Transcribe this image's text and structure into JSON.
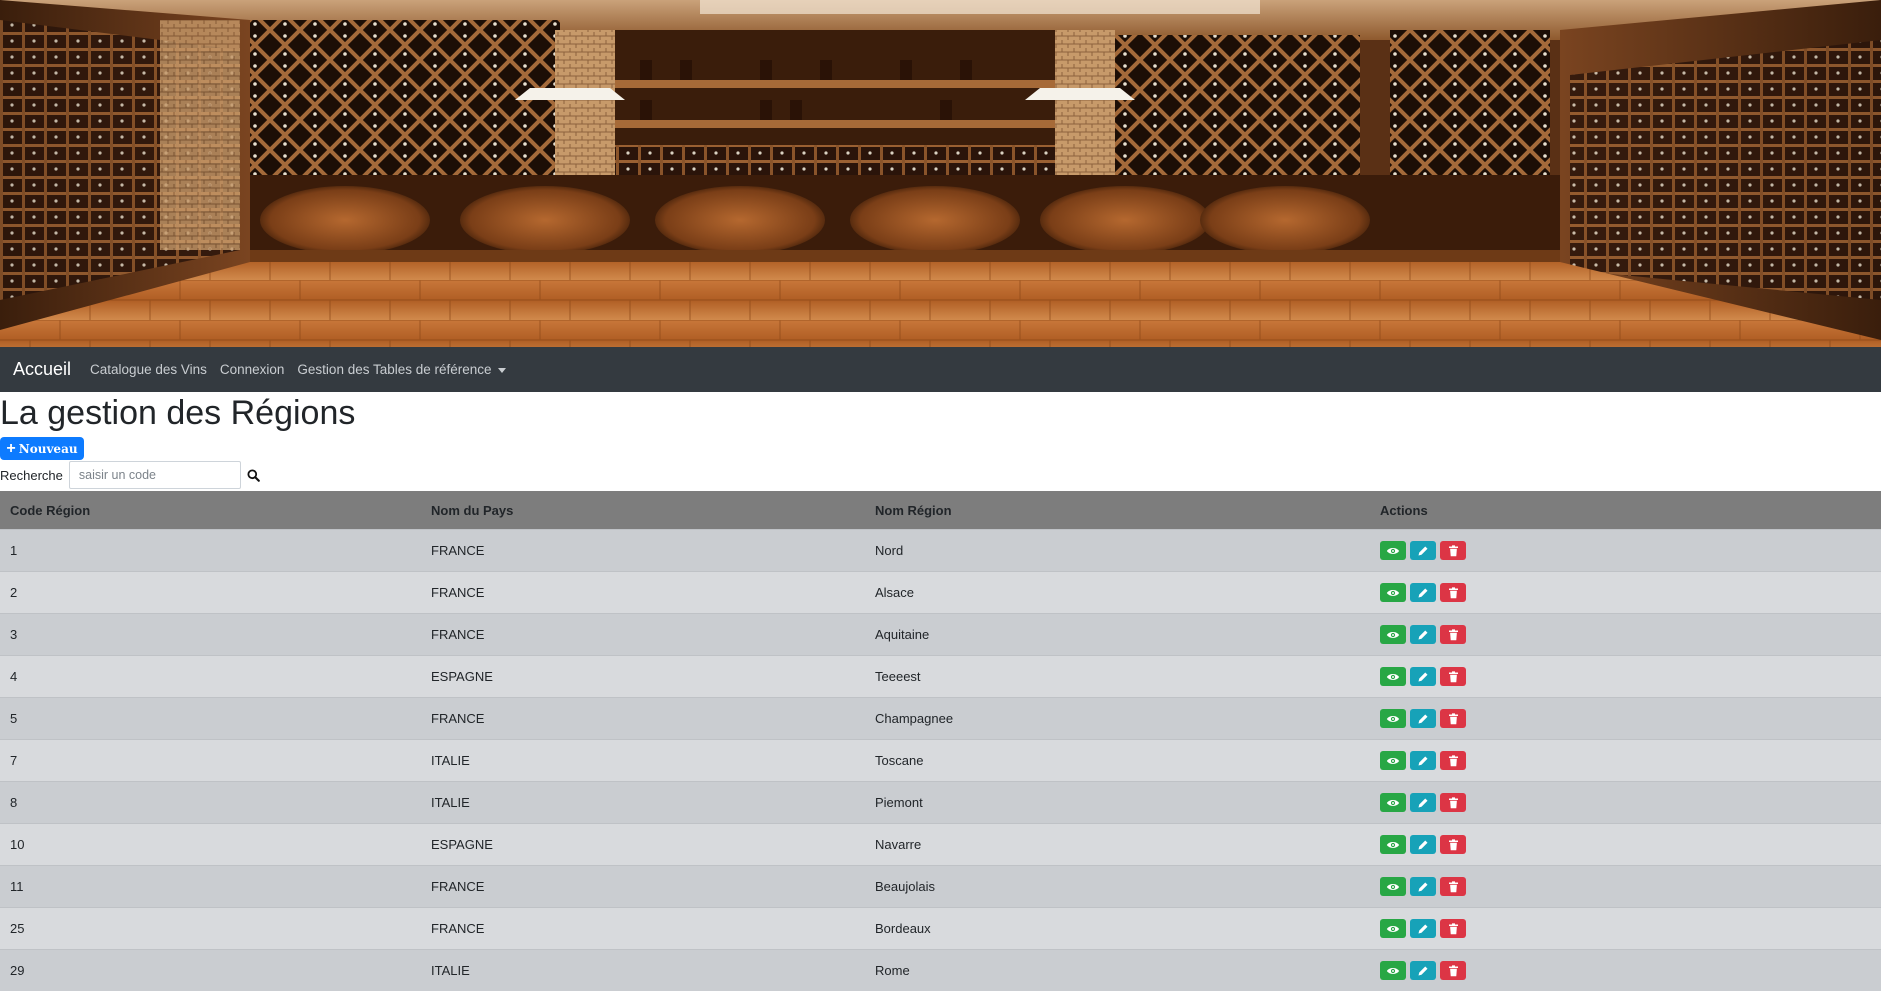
{
  "navbar": {
    "brand": "Accueil",
    "links": [
      "Catalogue des Vins",
      "Connexion",
      "Gestion des Tables de référence"
    ]
  },
  "page": {
    "title": "La gestion des Régions",
    "new_button": "Nouveau"
  },
  "search": {
    "label": "Recherche",
    "placeholder": "saisir un code",
    "value": ""
  },
  "table": {
    "headers": [
      "Code Région",
      "Nom du Pays",
      "Nom Région",
      "Actions"
    ],
    "rows": [
      {
        "code": "1",
        "pays": "FRANCE",
        "region": "Nord"
      },
      {
        "code": "2",
        "pays": "FRANCE",
        "region": "Alsace"
      },
      {
        "code": "3",
        "pays": "FRANCE",
        "region": "Aquitaine"
      },
      {
        "code": "4",
        "pays": "ESPAGNE",
        "region": "Teeeest"
      },
      {
        "code": "5",
        "pays": "FRANCE",
        "region": "Champagnee"
      },
      {
        "code": "7",
        "pays": "ITALIE",
        "region": "Toscane"
      },
      {
        "code": "8",
        "pays": "ITALIE",
        "region": "Piemont"
      },
      {
        "code": "10",
        "pays": "ESPAGNE",
        "region": "Navarre"
      },
      {
        "code": "11",
        "pays": "FRANCE",
        "region": "Beaujolais"
      },
      {
        "code": "25",
        "pays": "FRANCE",
        "region": "Bordeaux"
      },
      {
        "code": "29",
        "pays": "ITALIE",
        "region": "Rome"
      }
    ]
  },
  "action_icons": [
    "eye-icon",
    "pencil-icon",
    "trash-icon"
  ],
  "colors": {
    "navbar": "#343a40",
    "primary": "#0d7bff",
    "view": "#28a745",
    "edit": "#17a2b8",
    "delete": "#dc3545",
    "table_header": "#7d7d7d"
  }
}
